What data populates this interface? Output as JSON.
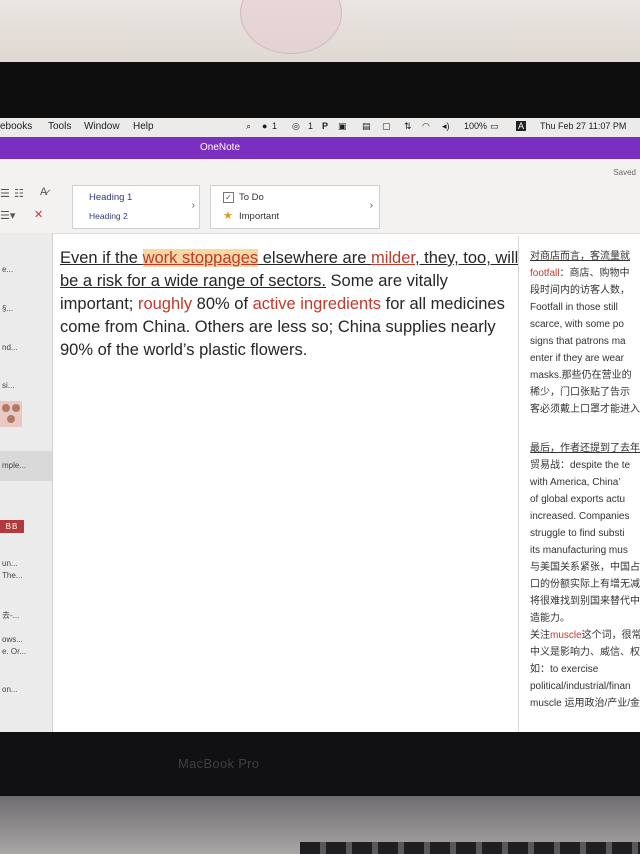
{
  "menubar": {
    "items": [
      "ebooks",
      "Tools",
      "Window",
      "Help"
    ],
    "counts": [
      "1",
      "1"
    ],
    "battery": "100%",
    "input_source": "A",
    "datetime": "Thu Feb 27  11:07 PM"
  },
  "window": {
    "title": "OneNote",
    "saved": "Saved"
  },
  "ribbon": {
    "styles": [
      "Heading 1",
      "Heading 2"
    ],
    "tags": [
      "To Do",
      "Important"
    ]
  },
  "sidebar": {
    "pages": [
      "e...",
      "§...",
      "nd...",
      "si...",
      "mple...",
      "un...",
      "The...",
      "去-...",
      "ows...",
      "e. Or...",
      "on..."
    ]
  },
  "note": {
    "segments": [
      "Even if the ",
      "work stoppages",
      " elsewhere are ",
      "milder",
      ", they, too, will be a risk for a wide range of sectors.",
      " Some are vitally important; ",
      "roughly",
      " 80% of ",
      "active ingredients",
      " for all medicines come from China. Others are less so; China supplies nearly 90% of the world’s plastic flowers."
    ]
  },
  "annotation": {
    "lines": [
      "对商店而言，客流量就",
      "footfall：商店、购物中",
      "段时间内的访客人数，",
      "Footfall in those still",
      "scarce, with some po",
      "signs that patrons ma",
      "enter if they are wear",
      "masks.那些仍在营业的",
      "稀少，门口张贴了告示",
      "客必须戴上口罩才能进入",
      "最后，作者还提到了去年",
      "贸易战：despite the te",
      "with America, China’",
      "of global exports actu",
      "increased. Companies",
      "struggle to find substi",
      "its manufacturing mus",
      "与美国关系紧张，中国占",
      "口的份额实际上有增无减",
      "将很难找到别国来替代中",
      "造能力。",
      "关注",
      "muscle",
      "这个词，很常",
      "中义是影响力、威信、权",
      "如：to exercise",
      "political/industrial/finan",
      "muscle 运用政治/产业/金"
    ]
  },
  "device": {
    "label": "MacBook Pro"
  }
}
